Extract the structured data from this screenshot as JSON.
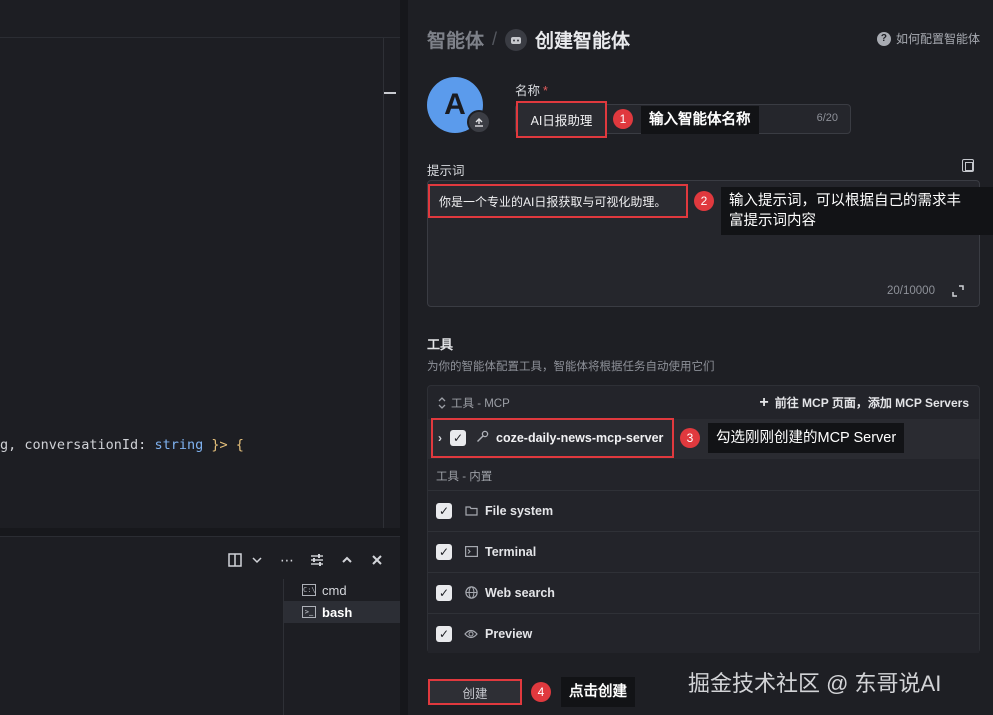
{
  "editor": {
    "code_prefix": "g, conversationId: ",
    "code_type": "string",
    "code_suffix": " }> {"
  },
  "terminal": {
    "toolbar": [
      "split-icon",
      "chevron-down-icon",
      "more-icon",
      "settings-icon",
      "chevron-up-icon",
      "close-icon"
    ],
    "tabs": [
      {
        "label": "cmd",
        "icon": "cmd-icon"
      },
      {
        "label": "bash",
        "icon": "terminal-icon"
      }
    ]
  },
  "panel": {
    "breadcrumb_root": "智能体",
    "breadcrumb_sep": "/",
    "breadcrumb_current": "创建智能体",
    "help_label": "如何配置智能体",
    "avatar_letter": "A",
    "name_label": "名称",
    "name_required": "*",
    "name_value": "AI日报助理",
    "name_count": "6/20",
    "prompt_label": "提示词",
    "prompt_value": "你是一个专业的AI日报获取与可视化助理。",
    "prompt_count": "20/10000",
    "tools_title": "工具",
    "tools_desc": "为你的智能体配置工具，智能体将根据任务自动使用它们",
    "mcp_label": "工具 - MCP",
    "mcp_link": "前往 MCP 页面，添加 MCP Servers",
    "mcp_server": "coze-daily-news-mcp-server",
    "builtin_label": "工具 - 内置",
    "builtin_tools": [
      {
        "label": "File system",
        "icon": "folder-icon",
        "checked": true
      },
      {
        "label": "Terminal",
        "icon": "terminal-icon",
        "checked": true
      },
      {
        "label": "Web search",
        "icon": "globe-icon",
        "checked": true
      },
      {
        "label": "Preview",
        "icon": "eye-icon",
        "checked": true
      }
    ],
    "create_button": "创建"
  },
  "annotations": {
    "step1": "1",
    "step1_text": "输入智能体名称",
    "step2": "2",
    "step2_text_line1": "输入提示词，可以根据自己的需求丰",
    "step2_text_line2": "富提示词内容",
    "step3": "3",
    "step3_text": "勾选刚刚创建的MCP Server",
    "step4": "4",
    "step4_text": "点击创建"
  },
  "watermark": "掘金技术社区 @ 东哥说AI",
  "colors": {
    "accent_red": "#e0393e",
    "avatar_blue": "#5b9bec",
    "background": "#1e1f24"
  }
}
